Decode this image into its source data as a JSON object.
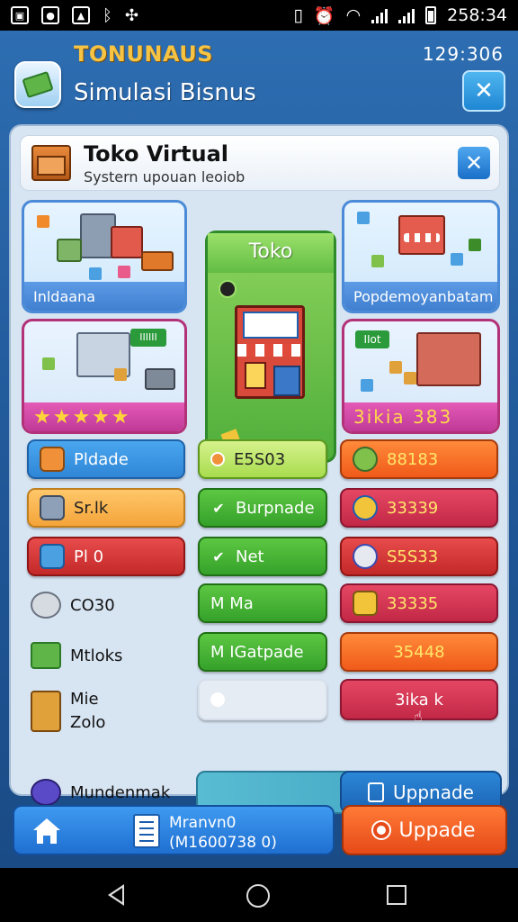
{
  "status_bar": {
    "time": "258:34"
  },
  "header": {
    "brand": "TONUNAUS",
    "title": "Simulasi Bisnus",
    "counter": "129:306"
  },
  "panel": {
    "title": "Toko Virtual",
    "subtitle": "Systern upouan leoiob"
  },
  "tiles": {
    "top_left_label": "Inldaana",
    "top_right_label": "Popdemoyanbatam",
    "center_title": "Toko",
    "mid_left_stars": "★★★★★",
    "mid_right_label": "3ikia 383",
    "mid_left_sign": "IIIIII",
    "mid_right_sign": "IIot"
  },
  "left_column": {
    "plado": "Pldade",
    "stok": "Sr.lk",
    "pro": "Pl 0",
    "cogo": "CO30",
    "mtloks": "Mtloks",
    "mie_1": "Mie",
    "mie_2": "Zolo",
    "munden": "Mundenmak"
  },
  "middle_column": {
    "stat1": "E5S03",
    "stat2": "Burpnade",
    "stat3": "Net",
    "stat4": "M Ma",
    "stat5": "M IGatpade"
  },
  "right_column": {
    "v1": "88183",
    "v2": "33339",
    "v3": "S5S33",
    "v4": "33335",
    "v5": "35448",
    "v6": "3ika k"
  },
  "actions": {
    "upgrade_small": "Uppnade",
    "bottom_l1": "Mranvn0",
    "bottom_l2": "(M1600738 0)",
    "bottom_upgrade": "Uppade"
  },
  "colors": {
    "brand_gold": "#f6c343",
    "panel_bg": "#d7e4f2",
    "app_bg": "#2d6db1"
  }
}
